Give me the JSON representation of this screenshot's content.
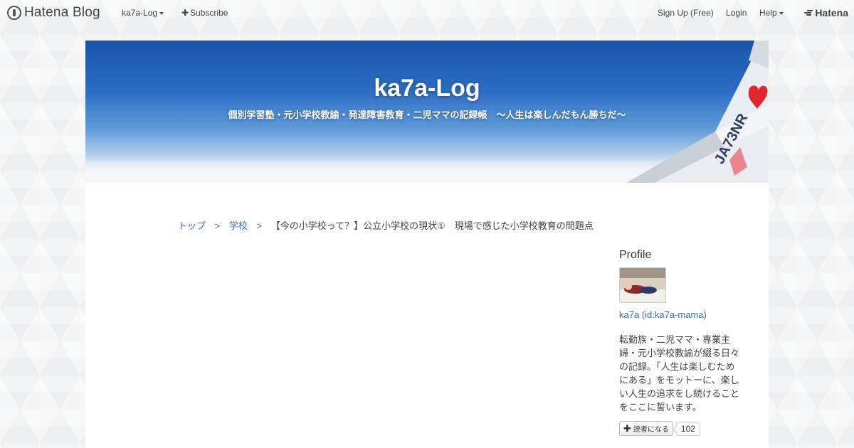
{
  "topbar": {
    "logo_text": "Hatena Blog",
    "blog_menu": "ka7a-Log",
    "subscribe": "Subscribe",
    "signup": "Sign Up (Free)",
    "login": "Login",
    "help": "Help",
    "brand": "Hatena"
  },
  "header": {
    "title": "ka7a-Log",
    "description": "個別学習塾・元小学校教諭・発達障害教育・二児ママの記録帳　〜人生は楽しんだもん勝ちだ〜"
  },
  "breadcrumb": {
    "items": [
      "トップ",
      "学校"
    ],
    "separator": ">",
    "current": "【今の小学校って？】公立小学校の現状①　現場で感じた小学校教育の問題点"
  },
  "sidebar": {
    "heading": "Profile",
    "profile_name": "ka7a (id:ka7a-mama)",
    "description": "転勤族・二児ママ・専業主婦・元小学校教諭が綴る日々の記録。「人生は楽しむためにある」をモットーに、楽しい人生の追求をし続けることをここに誓います。",
    "subscribe_label": "読者になる",
    "subscriber_count": "102"
  },
  "colors": {
    "link": "#3470b4",
    "wing_heart": "#e0262f",
    "sky_top": "#1a54a8"
  }
}
